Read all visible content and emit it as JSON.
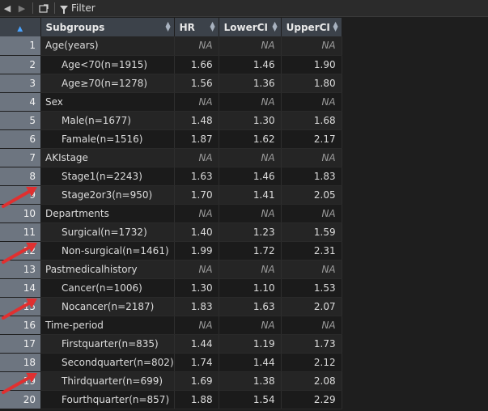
{
  "toolbar": {
    "back_icon": "back-arrow-icon",
    "forward_icon": "forward-arrow-icon",
    "show_in_window_icon": "show-in-window-icon",
    "filter_label": "Filter",
    "filter_icon": "funnel-icon"
  },
  "table": {
    "columns": [
      "Subgroups",
      "HR",
      "LowerCI",
      "UpperCI"
    ],
    "rows": [
      {
        "n": "1",
        "label": "Age(years)",
        "indent": false,
        "hr": "NA",
        "lo": "NA",
        "up": "NA"
      },
      {
        "n": "2",
        "label": "Age<70(n=1915)",
        "indent": true,
        "hr": "1.66",
        "lo": "1.46",
        "up": "1.90"
      },
      {
        "n": "3",
        "label": "Age≥70(n=1278)",
        "indent": true,
        "hr": "1.56",
        "lo": "1.36",
        "up": "1.80"
      },
      {
        "n": "4",
        "label": "Sex",
        "indent": false,
        "hr": "NA",
        "lo": "NA",
        "up": "NA"
      },
      {
        "n": "5",
        "label": "Male(n=1677)",
        "indent": true,
        "hr": "1.48",
        "lo": "1.30",
        "up": "1.68"
      },
      {
        "n": "6",
        "label": "Famale(n=1516)",
        "indent": true,
        "hr": "1.87",
        "lo": "1.62",
        "up": "2.17"
      },
      {
        "n": "7",
        "label": "AKIstage",
        "indent": false,
        "hr": "NA",
        "lo": "NA",
        "up": "NA"
      },
      {
        "n": "8",
        "label": "Stage1(n=2243)",
        "indent": true,
        "hr": "1.63",
        "lo": "1.46",
        "up": "1.83"
      },
      {
        "n": "9",
        "label": "Stage2or3(n=950)",
        "indent": true,
        "hr": "1.70",
        "lo": "1.41",
        "up": "2.05"
      },
      {
        "n": "10",
        "label": "Departments",
        "indent": false,
        "hr": "NA",
        "lo": "NA",
        "up": "NA"
      },
      {
        "n": "11",
        "label": "Surgical(n=1732)",
        "indent": true,
        "hr": "1.40",
        "lo": "1.23",
        "up": "1.59"
      },
      {
        "n": "12",
        "label": "Non-surgical(n=1461)",
        "indent": true,
        "hr": "1.99",
        "lo": "1.72",
        "up": "2.31"
      },
      {
        "n": "13",
        "label": "Pastmedicalhistory",
        "indent": false,
        "hr": "NA",
        "lo": "NA",
        "up": "NA"
      },
      {
        "n": "14",
        "label": "Cancer(n=1006)",
        "indent": true,
        "hr": "1.30",
        "lo": "1.10",
        "up": "1.53"
      },
      {
        "n": "15",
        "label": "Nocancer(n=2187)",
        "indent": true,
        "hr": "1.83",
        "lo": "1.63",
        "up": "2.07"
      },
      {
        "n": "16",
        "label": "Time-period",
        "indent": false,
        "hr": "NA",
        "lo": "NA",
        "up": "NA"
      },
      {
        "n": "17",
        "label": "Firstquarter(n=835)",
        "indent": true,
        "hr": "1.44",
        "lo": "1.19",
        "up": "1.73"
      },
      {
        "n": "18",
        "label": "Secondquarter(n=802)",
        "indent": true,
        "hr": "1.74",
        "lo": "1.44",
        "up": "2.12"
      },
      {
        "n": "19",
        "label": "Thirdquarter(n=699)",
        "indent": true,
        "hr": "1.69",
        "lo": "1.38",
        "up": "2.08"
      },
      {
        "n": "20",
        "label": "Fourthquarter(n=857)",
        "indent": true,
        "hr": "1.88",
        "lo": "1.54",
        "up": "2.29"
      }
    ]
  },
  "annotations": {
    "arrow_color": "#e03030",
    "arrow_icon": "red-annotation-arrow-icon",
    "arrow_rows": [
      "9",
      "12",
      "15",
      "19"
    ]
  }
}
